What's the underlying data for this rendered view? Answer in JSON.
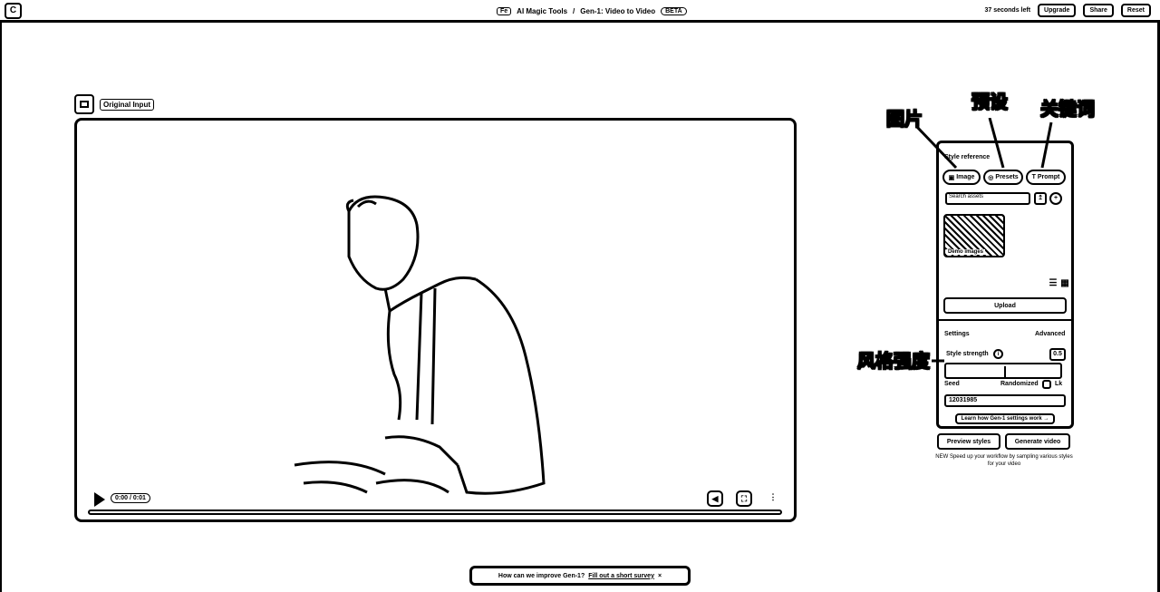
{
  "topbar": {
    "logo": "C",
    "badge": "Fe",
    "crumb1": "AI Magic Tools",
    "separator": "/",
    "crumb2": "Gen-1: Video to Video",
    "beta": "BETA",
    "time_left": "37 seconds left",
    "upgrade": "Upgrade",
    "share": "Share",
    "reset": "Reset"
  },
  "input": {
    "label": "Original Input",
    "time": "0:00 / 0:01"
  },
  "panel": {
    "style_reference": "Style reference",
    "tab_image": "Image",
    "tab_presets": "Presets",
    "tab_prompt": "Prompt",
    "search_placeholder": "Search assets",
    "thumb_label": "Demo images",
    "upload": "Upload",
    "settings": "Settings",
    "advanced": "Advanced",
    "style_strength": "Style strength",
    "strength_value": "0.5",
    "strength_fraction": 0.52,
    "seed": "Seed",
    "randomized": "Randomized",
    "lock": "Lk",
    "seed_value": "12031985",
    "learn_more": "Learn how Gen-1 settings work →",
    "preview": "Preview styles",
    "generate": "Generate video",
    "note": "NEW Speed up your workflow by sampling various styles for your video"
  },
  "annotations": {
    "image": "图片",
    "presets": "预设",
    "prompt": "关键词",
    "strength": "风格强度"
  },
  "survey": {
    "text": "How can we improve Gen-1?",
    "link": "Fill out a short survey"
  }
}
